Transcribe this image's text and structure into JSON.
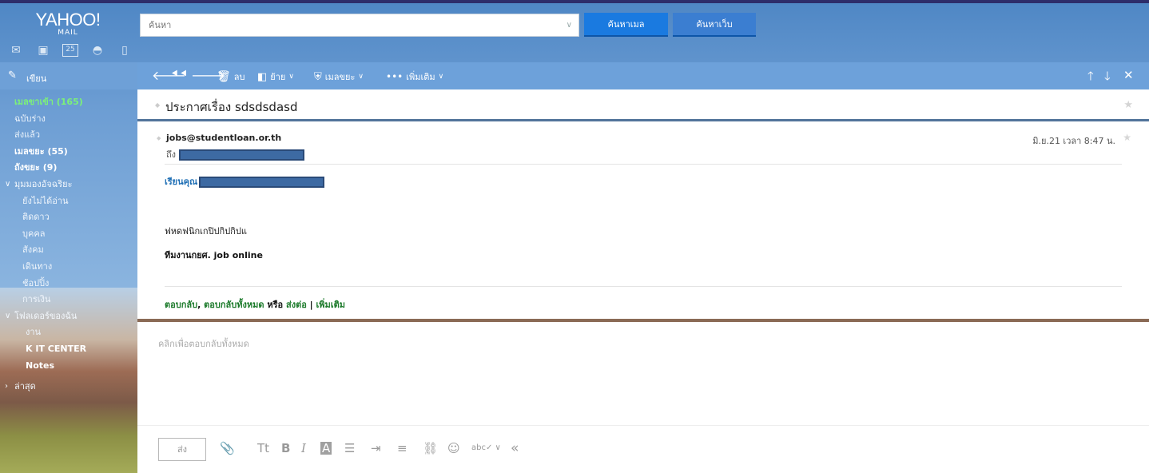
{
  "brand": {
    "logo_line1": "YAHOO!",
    "logo_line2": "MAIL"
  },
  "search": {
    "placeholder": "ค้นหา",
    "mail_button": "ค้นหาเมล",
    "web_button": "ค้นหาเว็บ"
  },
  "compose": {
    "label": "เขียน"
  },
  "toolbar": {
    "delete_label": "ลบ",
    "move_label": "ย้าย",
    "spam_label": "เมลขยะ",
    "more_label": "เพิ่มเติม"
  },
  "sidebar": {
    "inbox": "เมลขาเข้า (165)",
    "drafts": "ฉบับร่าง",
    "sent": "ส่งแล้ว",
    "spam": "เมลขยะ (55)",
    "trash": "ถังขยะ (9)",
    "smart_views": "มุมมองอัจฉริยะ",
    "smart_items": [
      "ยังไม่ได้อ่าน",
      "ติดดาว",
      "บุคคล",
      "สังคม",
      "เดินทาง",
      "ช้อปปิ้ง",
      "การเงิน"
    ],
    "folders": "โฟลเดอร์ของฉัน",
    "folder_items": [
      "งาน",
      "K IT CENTER",
      "Notes"
    ],
    "recent": "ล่าสุด"
  },
  "message": {
    "subject": "ประกาศเรื่อง sdsdsdasd",
    "sender": "jobs@studentloan.or.th",
    "to_label": "ถึง",
    "date": "มิ.ย.21 เวลา 8:47 น.",
    "greeting": "เรียนคุณ",
    "body_line1": "ฟหดฟนิกเกปิปกิปกิปแ",
    "body_line2": "ทีมงานกยศ. job online",
    "reply_link": "ตอบกลับ",
    "reply_all_link": "ตอบกลับทั้งหมด",
    "or_text": "หรือ",
    "forward_link": "ส่งต่อ",
    "separator": "|",
    "more_link": "เพิ่มเติม"
  },
  "reply_box": {
    "placeholder": "คลิกเพื่อตอบกลับทั้งหมด",
    "send_button": "ส่ง"
  }
}
